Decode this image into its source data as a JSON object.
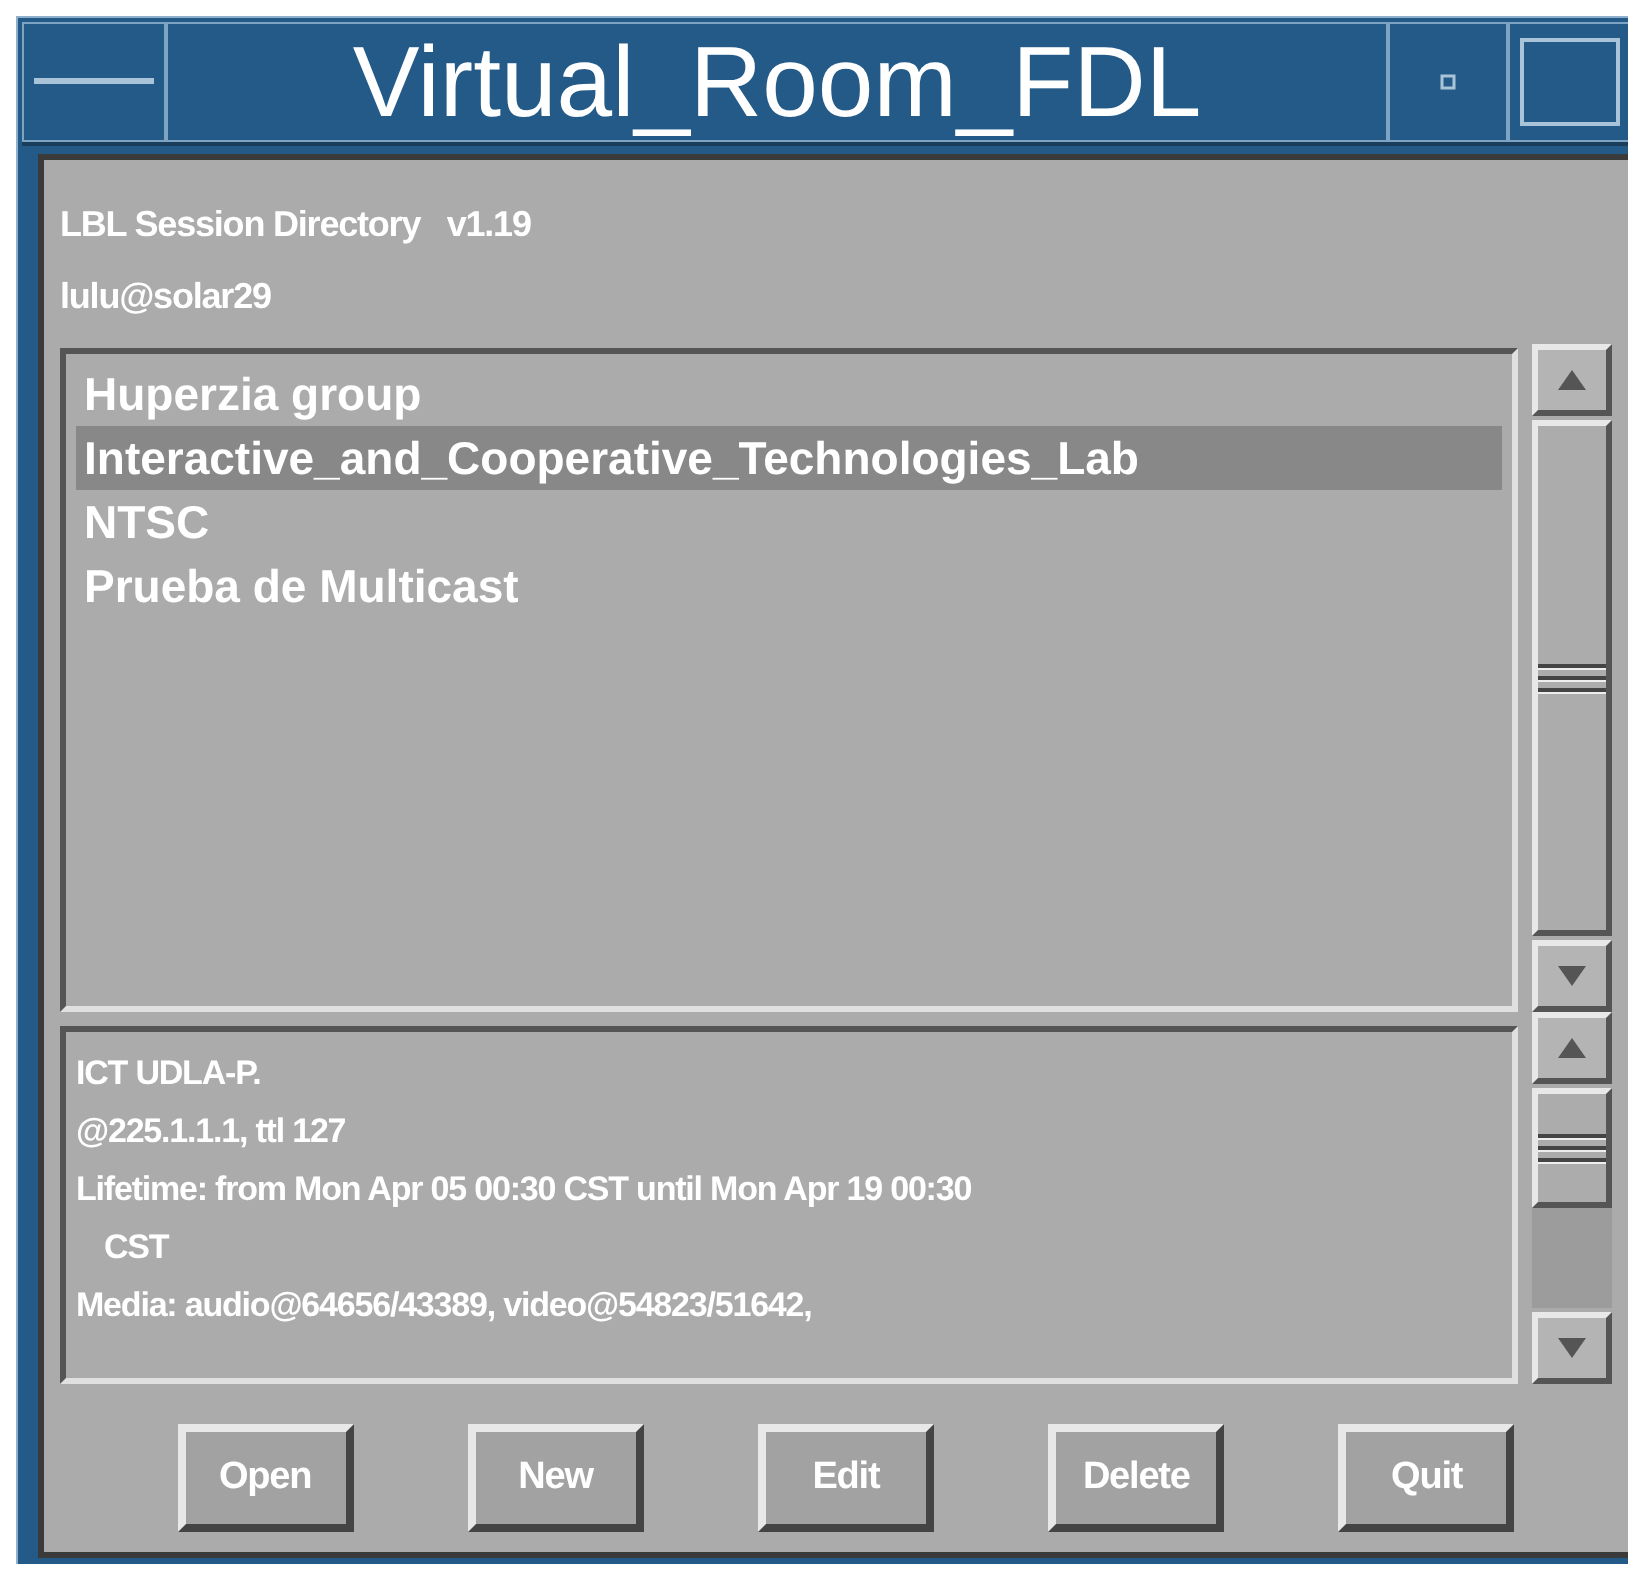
{
  "window": {
    "title": "Virtual_Room_FDL"
  },
  "header": {
    "app": "LBL Session Directory   v1.19",
    "user": "lulu@solar29"
  },
  "sessions": [
    {
      "name": "Huperzia group",
      "selected": false
    },
    {
      "name": "Interactive_and_Cooperative_Technologies_Lab",
      "selected": true
    },
    {
      "name": "NTSC",
      "selected": false
    },
    {
      "name": "Prueba de Multicast",
      "selected": false
    }
  ],
  "details": [
    {
      "text": "ICT UDLA-P.",
      "continued": false
    },
    {
      "text": "@225.1.1.1, ttl 127",
      "continued": false
    },
    {
      "text": "Lifetime: from Mon Apr 05 00:30 CST until Mon Apr 19 00:30",
      "continued": false
    },
    {
      "text": "CST",
      "continued": true
    },
    {
      "text": "Media: audio@64656/43389, video@54823/51642,",
      "continued": false
    }
  ],
  "buttons": [
    "Open",
    "New",
    "Edit",
    "Delete",
    "Quit"
  ]
}
